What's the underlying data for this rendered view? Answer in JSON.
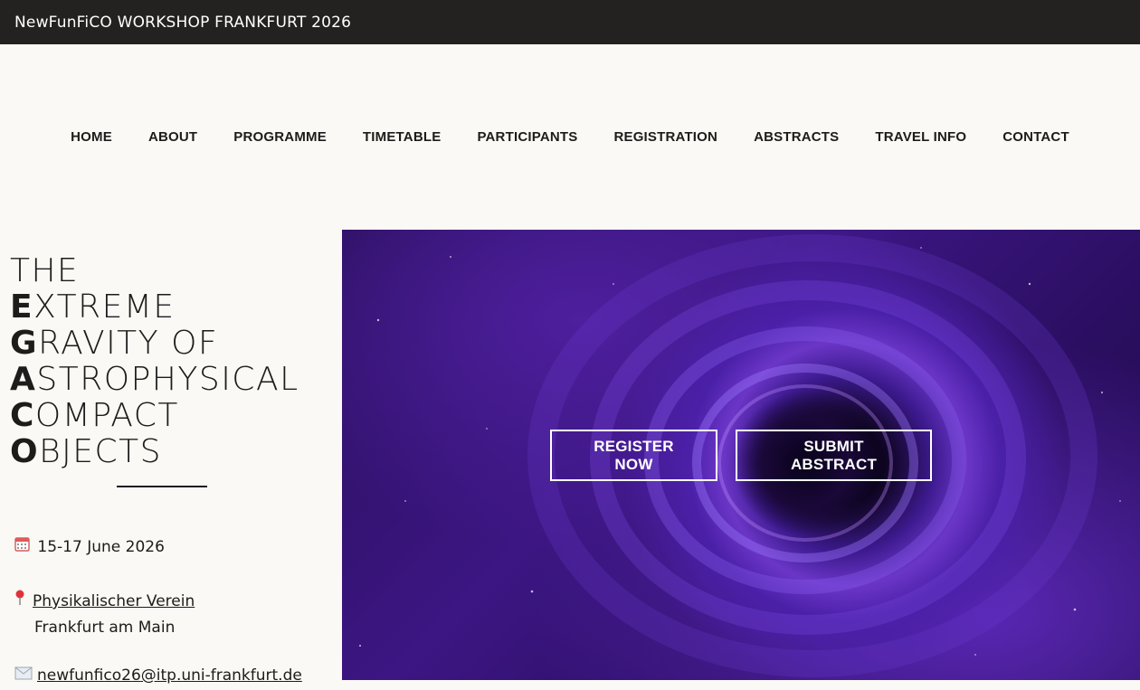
{
  "topbar": {
    "title": "NewFunFiCO WORKSHOP FRANKFURT 2026"
  },
  "nav": {
    "items": [
      {
        "label": "HOME"
      },
      {
        "label": "ABOUT"
      },
      {
        "label": "PROGRAMME"
      },
      {
        "label": "TIMETABLE"
      },
      {
        "label": "PARTICIPANTS"
      },
      {
        "label": "REGISTRATION"
      },
      {
        "label": "ABSTRACTS"
      },
      {
        "label": "TRAVEL INFO"
      },
      {
        "label": "CONTACT"
      }
    ]
  },
  "title": {
    "line1": "THE",
    "lines": [
      {
        "cap": "E",
        "rest": "XTREME"
      },
      {
        "cap": "G",
        "rest": "RAVITY OF"
      },
      {
        "cap": "A",
        "rest": "STROPHYSICAL"
      },
      {
        "cap": "C",
        "rest": "OMPACT"
      },
      {
        "cap": "O",
        "rest": "BJECTS"
      }
    ]
  },
  "info": {
    "date": "15-17 June 2026",
    "venue_link": "Physikalischer Verein",
    "venue_city": "Frankfurt am Main",
    "email": "newfunfico26@itp.uni-frankfurt.de",
    "icons": {
      "date": "calendar-icon",
      "venue": "pin-icon",
      "email": "envelope-icon"
    }
  },
  "hero": {
    "register_label": "REGISTER NOW",
    "abstract_label": "SUBMIT ABSTRACT"
  },
  "colors": {
    "topbar_bg": "#232220",
    "page_bg": "#faf9f5",
    "hero_purple": "#4b20a8"
  }
}
